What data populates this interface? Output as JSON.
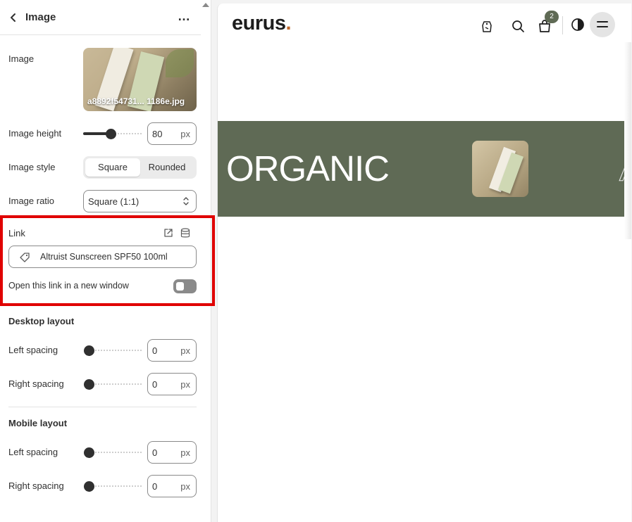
{
  "panel": {
    "title": "Image",
    "more_label": "…",
    "image_label": "Image",
    "image_filename": "a8892f54731... 1186e.jpg",
    "image_height_label": "Image height",
    "image_height_value": "80",
    "image_height_unit": "px",
    "image_height_slider_fraction": 0.46,
    "image_style_label": "Image style",
    "image_style_options": [
      "Square",
      "Rounded"
    ],
    "image_style_selected": "Square",
    "image_ratio_label": "Image ratio",
    "image_ratio_value": "Square (1:1)",
    "link_label": "Link",
    "link_value": "Altruist Sunscreen SPF50 100ml",
    "new_window_label": "Open this link in a new window",
    "new_window_on": false,
    "desktop_section": "Desktop layout",
    "mobile_section": "Mobile layout",
    "left_spacing_label": "Left spacing",
    "right_spacing_label": "Right spacing",
    "desktop_left_value": "0",
    "desktop_right_value": "0",
    "mobile_left_value": "0",
    "mobile_right_value": "0",
    "unit": "px"
  },
  "preview": {
    "logo_text": "eurus",
    "logo_dot": ".",
    "cart_count": "2",
    "band_text": "ORGANIC",
    "band_ghost_text": "A",
    "band_color": "#5f6a55",
    "accent_color": "#c0682b",
    "icons": [
      "tag-icon",
      "search-icon",
      "cart-icon",
      "theme-toggle-icon",
      "menu-icon"
    ]
  }
}
